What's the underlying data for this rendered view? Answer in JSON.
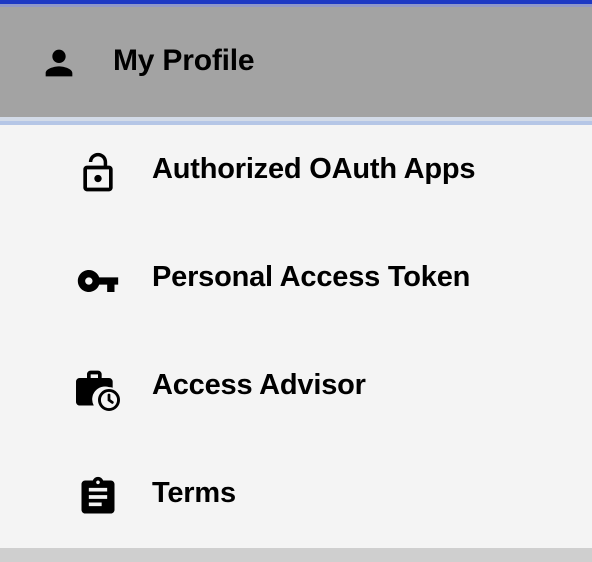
{
  "header": {
    "title": "My Profile",
    "icon": "person-icon"
  },
  "menu": {
    "items": [
      {
        "label": "Authorized OAuth Apps",
        "icon": "lock-open-icon"
      },
      {
        "label": "Personal Access Token",
        "icon": "key-icon"
      },
      {
        "label": "Access Advisor",
        "icon": "work-history-icon"
      },
      {
        "label": "Terms",
        "icon": "clipboard-icon"
      }
    ]
  },
  "colors": {
    "top_accent": "#1d39c4",
    "header_bg": "#a3a3a3",
    "divider": "#b5c6e6",
    "menu_bg": "#f4f4f4",
    "footer_bg": "#cfcfcf"
  }
}
